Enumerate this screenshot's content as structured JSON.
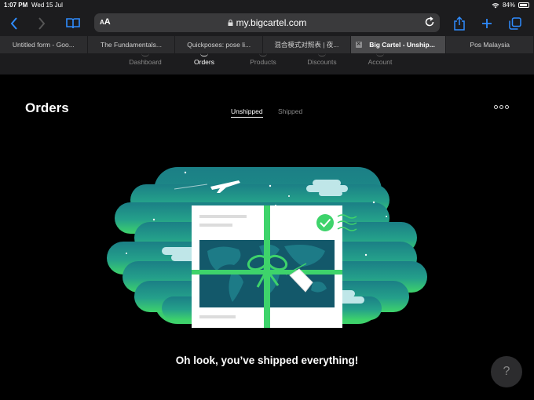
{
  "status": {
    "time": "1:07 PM",
    "date": "Wed 15 Jul",
    "battery": "84%"
  },
  "toolbar": {
    "text_size_label_small": "A",
    "text_size_label_large": "A",
    "url": "my.bigcartel.com"
  },
  "tabs": [
    {
      "label": "Untitled form - Goo...",
      "active": false
    },
    {
      "label": "The Fundamentals...",
      "active": false
    },
    {
      "label": "Quickposes: pose li...",
      "active": false
    },
    {
      "label": "混合模式对照表 | 夜...",
      "active": false
    },
    {
      "label": "Big Cartel - Unship...",
      "active": true
    },
    {
      "label": "Pos Malaysia",
      "active": false
    }
  ],
  "appnav": {
    "dashboard": "Dashboard",
    "orders": "Orders",
    "products": "Products",
    "discounts": "Discounts",
    "account": "Account"
  },
  "main": {
    "title": "Orders",
    "tab_unshipped": "Unshipped",
    "tab_shipped": "Shipped",
    "empty_message": "Oh look, you’ve shipped everything!",
    "help_label": "?"
  },
  "colors": {
    "accent": "#2f8cff",
    "green": "#33c46b",
    "teal": "#1e8a8f",
    "dark_teal": "#13586a"
  }
}
